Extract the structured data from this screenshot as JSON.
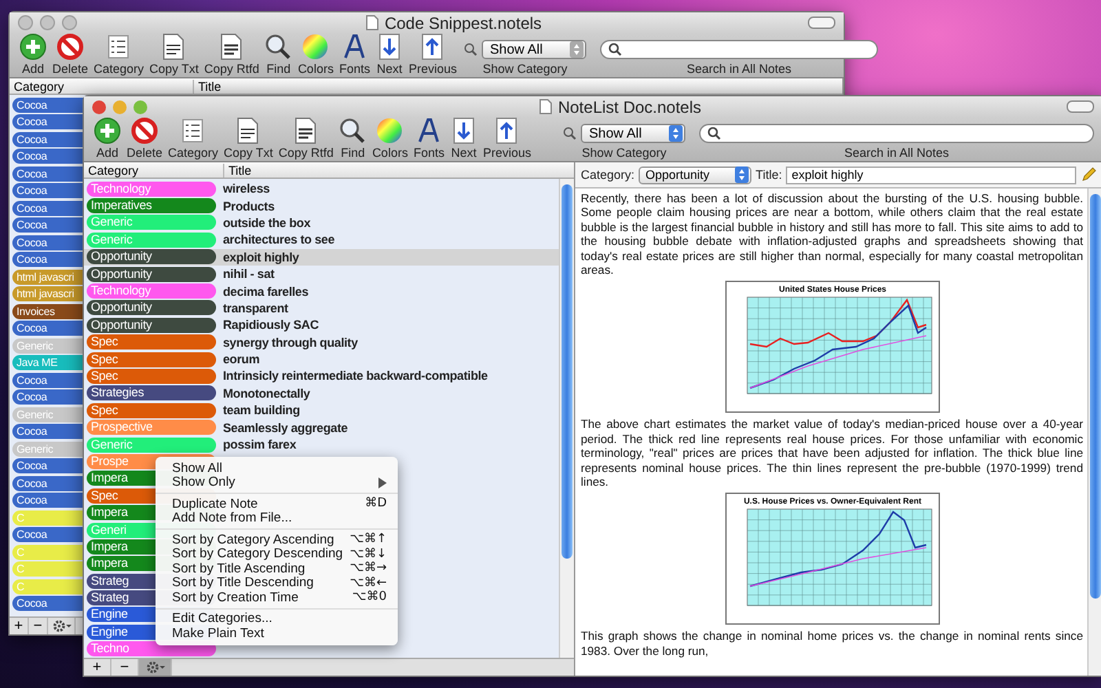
{
  "back_window": {
    "title": "Code Snippest.notels",
    "active": false,
    "toolbar": [
      {
        "label": "Add",
        "kind": "add"
      },
      {
        "label": "Delete",
        "kind": "delete"
      },
      {
        "label": "Category",
        "kind": "category"
      },
      {
        "label": "Copy Txt",
        "kind": "copy_txt"
      },
      {
        "label": "Copy Rtfd",
        "kind": "copy_rtfd"
      },
      {
        "label": "Find",
        "kind": "find"
      },
      {
        "label": "Colors",
        "kind": "colors"
      },
      {
        "label": "Fonts",
        "kind": "fonts"
      },
      {
        "label": "Next",
        "kind": "next"
      },
      {
        "label": "Previous",
        "kind": "previous"
      }
    ],
    "show_popup": {
      "value": "Show All",
      "label": "Show Category"
    },
    "search": {
      "label": "Search in All Notes"
    },
    "columns": [
      "Category",
      "Title"
    ],
    "rows": [
      {
        "category": "Cocoa",
        "color": "#3a68c8"
      },
      {
        "category": "Cocoa",
        "color": "#3a68c8"
      },
      {
        "category": "Cocoa",
        "color": "#3a68c8"
      },
      {
        "category": "Cocoa",
        "color": "#3a68c8"
      },
      {
        "category": "Cocoa",
        "color": "#3a68c8"
      },
      {
        "category": "Cocoa",
        "color": "#3a68c8"
      },
      {
        "category": "Cocoa",
        "color": "#3a68c8"
      },
      {
        "category": "Cocoa",
        "color": "#3a68c8"
      },
      {
        "category": "Cocoa",
        "color": "#3a68c8"
      },
      {
        "category": "Cocoa",
        "color": "#3a68c8"
      },
      {
        "category": "html javascri",
        "color": "#c89a2a"
      },
      {
        "category": "html javascri",
        "color": "#c89a2a"
      },
      {
        "category": "Invoices",
        "color": "#8a4a1a"
      },
      {
        "category": "Cocoa",
        "color": "#3a68c8"
      },
      {
        "category": "Generic",
        "color": "#c8c8c8"
      },
      {
        "category": "Java ME",
        "color": "#18bdbd"
      },
      {
        "category": "Cocoa",
        "color": "#3a68c8"
      },
      {
        "category": "Cocoa",
        "color": "#3a68c8"
      },
      {
        "category": "Generic",
        "color": "#c8c8c8"
      },
      {
        "category": "Cocoa",
        "color": "#3a68c8"
      },
      {
        "category": "Generic",
        "color": "#c8c8c8"
      },
      {
        "category": "Cocoa",
        "color": "#3a68c8"
      },
      {
        "category": "Cocoa",
        "color": "#3a68c8"
      },
      {
        "category": "Cocoa",
        "color": "#3a68c8"
      },
      {
        "category": "C",
        "color": "#e8ec48"
      },
      {
        "category": "Cocoa",
        "color": "#3a68c8"
      },
      {
        "category": "C",
        "color": "#e8ec48"
      },
      {
        "category": "C",
        "color": "#e8ec48"
      },
      {
        "category": "C",
        "color": "#e8ec48"
      },
      {
        "category": "Cocoa",
        "color": "#3a68c8"
      }
    ],
    "footer_buttons": [
      "+",
      "−"
    ],
    "gear_selected": false
  },
  "front_window": {
    "title": "NoteList Doc.notels",
    "active": true,
    "toolbar": [
      {
        "label": "Add",
        "kind": "add"
      },
      {
        "label": "Delete",
        "kind": "delete"
      },
      {
        "label": "Category",
        "kind": "category"
      },
      {
        "label": "Copy Txt",
        "kind": "copy_txt"
      },
      {
        "label": "Copy Rtfd",
        "kind": "copy_rtfd"
      },
      {
        "label": "Find",
        "kind": "find"
      },
      {
        "label": "Colors",
        "kind": "colors"
      },
      {
        "label": "Fonts",
        "kind": "fonts"
      },
      {
        "label": "Next",
        "kind": "next"
      },
      {
        "label": "Previous",
        "kind": "previous"
      }
    ],
    "show_popup": {
      "value": "Show All",
      "label": "Show Category"
    },
    "search": {
      "label": "Search in All Notes"
    },
    "columns": [
      "Category",
      "Title"
    ],
    "rows": [
      {
        "category": "Technology",
        "color": "#ff58ee",
        "title": "wireless",
        "selected": false
      },
      {
        "category": "Imperatives",
        "color": "#14881c",
        "title": "Products",
        "selected": false
      },
      {
        "category": "Generic",
        "color": "#22ee7a",
        "title": "outside the box",
        "selected": false
      },
      {
        "category": "Generic",
        "color": "#22ee7a",
        "title": "architectures to see",
        "selected": false
      },
      {
        "category": "Opportunity",
        "color": "#3e4a40",
        "title": "exploit highly",
        "selected": true
      },
      {
        "category": "Opportunity",
        "color": "#3e4a40",
        "title": "nihil - sat",
        "selected": false
      },
      {
        "category": "Technology",
        "color": "#ff58ee",
        "title": "decima farelles",
        "selected": false
      },
      {
        "category": "Opportunity",
        "color": "#3e4a40",
        "title": "transparent",
        "selected": false
      },
      {
        "category": "Opportunity",
        "color": "#3e4a40",
        "title": "Rapidiously SAC",
        "selected": false
      },
      {
        "category": "Spec",
        "color": "#dc5a08",
        "title": "synergy through quality",
        "selected": false
      },
      {
        "category": "Spec",
        "color": "#dc5a08",
        "title": "eorum",
        "selected": false
      },
      {
        "category": "Spec",
        "color": "#dc5a08",
        "title": "Intrinsicly reintermediate backward-compatible",
        "selected": false
      },
      {
        "category": "Strategies",
        "color": "#464a80",
        "title": "Monotonectally",
        "selected": false
      },
      {
        "category": "Spec",
        "color": "#dc5a08",
        "title": "team building",
        "selected": false
      },
      {
        "category": "Prospective",
        "color": "#ff8c48",
        "title": "Seamlessly aggregate",
        "selected": false
      },
      {
        "category": "Generic",
        "color": "#22ee7a",
        "title": "possim farex",
        "selected": false
      },
      {
        "category": "Prospe",
        "color": "#ff8c48",
        "selected": false
      },
      {
        "category": "Impera",
        "color": "#14881c",
        "selected": false
      },
      {
        "category": "Spec",
        "color": "#dc5a08",
        "selected": false
      },
      {
        "category": "Impera",
        "color": "#14881c",
        "selected": false
      },
      {
        "category": "Generi",
        "color": "#22ee7a",
        "selected": false
      },
      {
        "category": "Impera",
        "color": "#14881c",
        "selected": false
      },
      {
        "category": "Impera",
        "color": "#14881c",
        "selected": false
      },
      {
        "category": "Strateg",
        "color": "#464a80",
        "selected": false
      },
      {
        "category": "Strateg",
        "color": "#464a80",
        "selected": false
      },
      {
        "category": "Engine",
        "color": "#2a5ad8",
        "selected": false
      },
      {
        "category": "Engine",
        "color": "#2a5ad8",
        "selected": false
      },
      {
        "category": "Techno",
        "color": "#ff58ee",
        "selected": false
      }
    ],
    "footer_buttons": [
      "+",
      "−"
    ],
    "gear_selected": true,
    "editor": {
      "category_label": "Category:",
      "category_value": "Opportunity",
      "title_label": "Title:",
      "title_value": "exploit highly",
      "content": [
        {
          "kind": "paragraph",
          "text": "Recently, there has been a lot of discussion about the bursting of the U.S. housing bubble. Some people claim housing prices are near a bottom, while others claim that the real estate bubble is the largest financial bubble in history and still has more to fall. This site aims to add to the housing bubble debate with inflation-adjusted graphs and spreadsheets showing that today's real estate prices are still higher than normal, especially for many coastal metropolitan areas."
        },
        {
          "kind": "chart_image",
          "title": "United States House Prices"
        },
        {
          "kind": "paragraph",
          "text": "The above chart estimates the market value of today's median-priced house over a 40-year period. The thick red line represents real house prices. For those unfamiliar with economic terminology, \"real\" prices are prices that have been adjusted for inflation. The thick blue line represents nominal house prices. The thin lines represent the pre-bubble (1970-1999) trend lines."
        },
        {
          "kind": "chart_image",
          "title": "U.S. House Prices vs. Owner-Equivalent Rent"
        },
        {
          "kind": "paragraph",
          "text": "This graph shows the change in nominal home prices vs. the change in nominal rents since 1983. Over the long run,"
        }
      ]
    }
  },
  "context_menu": [
    {
      "kind": "item",
      "label": "Show All"
    },
    {
      "kind": "submenu",
      "label": "Show Only"
    },
    {
      "kind": "separator"
    },
    {
      "kind": "item",
      "label": "Duplicate Note",
      "shortcut": "⌘D"
    },
    {
      "kind": "item",
      "label": "Add Note from File..."
    },
    {
      "kind": "separator"
    },
    {
      "kind": "item",
      "label": "Sort by Category Ascending",
      "shortcut": "⌥⌘↑"
    },
    {
      "kind": "item",
      "label": "Sort by Category Descending",
      "shortcut": "⌥⌘↓"
    },
    {
      "kind": "item",
      "label": "Sort by Title Ascending",
      "shortcut": "⌥⌘→"
    },
    {
      "kind": "item",
      "label": "Sort by Title Descending",
      "shortcut": "⌥⌘←"
    },
    {
      "kind": "item",
      "label": "Sort by Creation Time",
      "shortcut": "⌥⌘0"
    },
    {
      "kind": "separator"
    },
    {
      "kind": "item",
      "label": "Edit Categories..."
    },
    {
      "kind": "item",
      "label": "Make Plain Text"
    }
  ]
}
